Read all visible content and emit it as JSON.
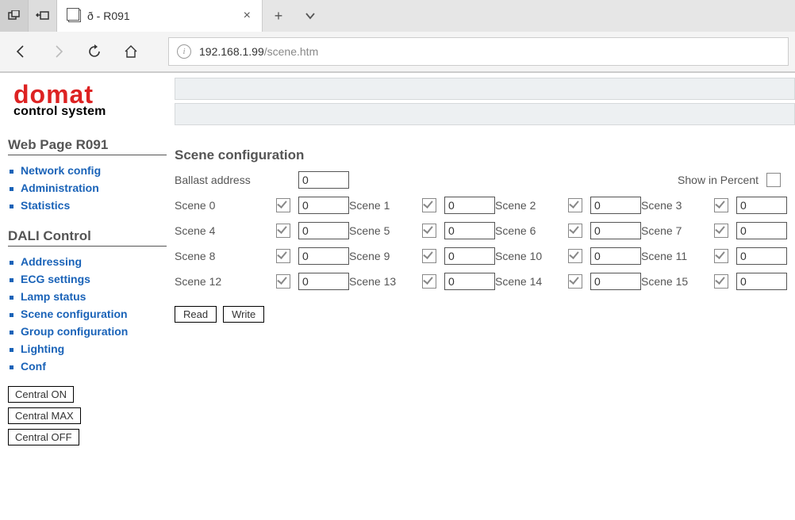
{
  "browser": {
    "tab_title": "ð - R091",
    "address_host": "192.168.1.99",
    "address_path": "/scene.htm"
  },
  "logo": {
    "brand": "domat",
    "sub": "control system"
  },
  "sidebar": {
    "section1_title": "Web Page R091",
    "nav1": [
      "Network config",
      "Administration",
      "Statistics"
    ],
    "section2_title": "DALI Control",
    "nav2": [
      "Addressing",
      "ECG settings",
      "Lamp status",
      "Scene configuration",
      "Group configuration",
      "Lighting",
      "Conf"
    ],
    "central_buttons": [
      "Central ON",
      "Central MAX",
      "Central OFF"
    ]
  },
  "main": {
    "title": "Scene configuration",
    "ballast_label": "Ballast address",
    "ballast_value": "0",
    "show_percent_label": "Show in Percent",
    "show_percent_checked": false,
    "scenes": [
      {
        "label": "Scene 0",
        "checked": true,
        "value": "0"
      },
      {
        "label": "Scene 1",
        "checked": true,
        "value": "0"
      },
      {
        "label": "Scene 2",
        "checked": true,
        "value": "0"
      },
      {
        "label": "Scene 3",
        "checked": true,
        "value": "0"
      },
      {
        "label": "Scene 4",
        "checked": true,
        "value": "0"
      },
      {
        "label": "Scene 5",
        "checked": true,
        "value": "0"
      },
      {
        "label": "Scene 6",
        "checked": true,
        "value": "0"
      },
      {
        "label": "Scene 7",
        "checked": true,
        "value": "0"
      },
      {
        "label": "Scene 8",
        "checked": true,
        "value": "0"
      },
      {
        "label": "Scene 9",
        "checked": true,
        "value": "0"
      },
      {
        "label": "Scene 10",
        "checked": true,
        "value": "0"
      },
      {
        "label": "Scene 11",
        "checked": true,
        "value": "0"
      },
      {
        "label": "Scene 12",
        "checked": true,
        "value": "0"
      },
      {
        "label": "Scene 13",
        "checked": true,
        "value": "0"
      },
      {
        "label": "Scene 14",
        "checked": true,
        "value": "0"
      },
      {
        "label": "Scene 15",
        "checked": true,
        "value": "0"
      }
    ],
    "read_label": "Read",
    "write_label": "Write"
  }
}
